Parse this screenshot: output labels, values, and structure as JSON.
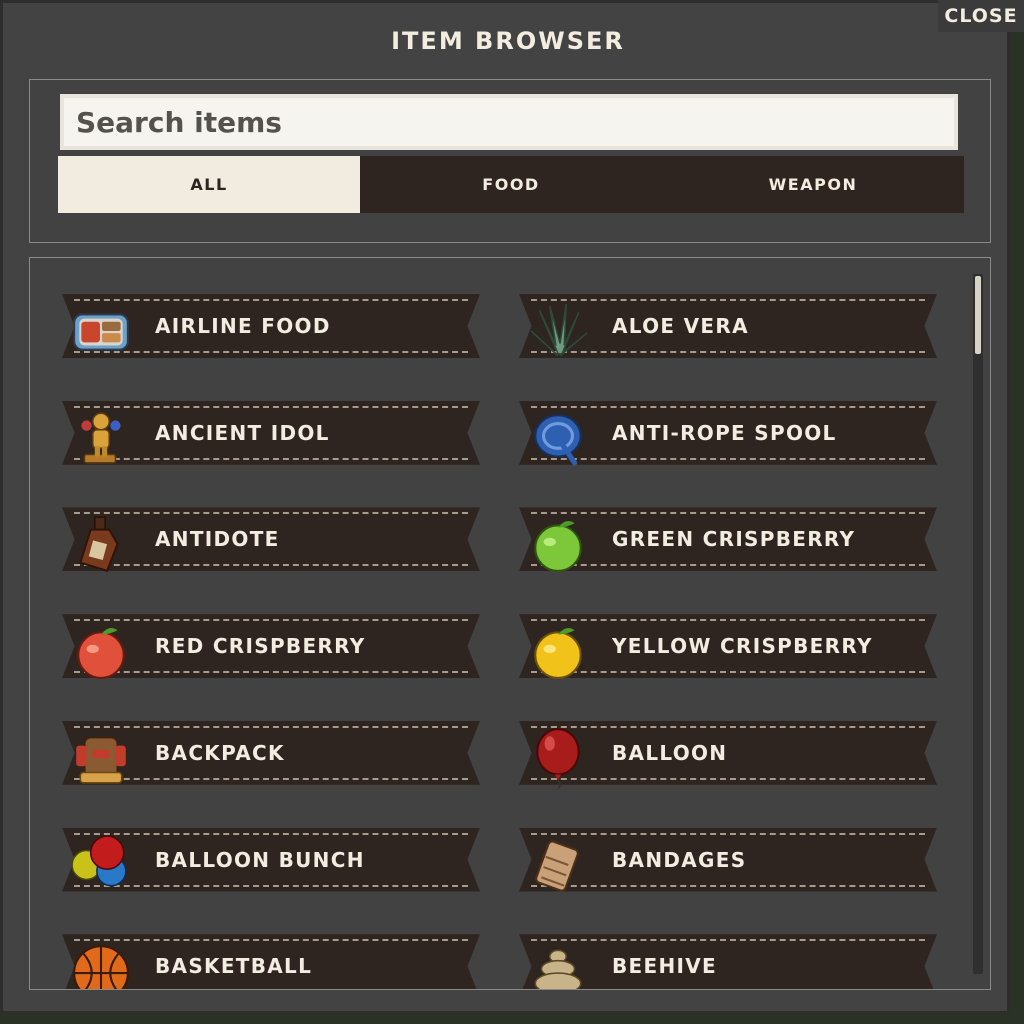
{
  "window": {
    "title": "ITEM BROWSER",
    "close_label": "CLOSE"
  },
  "search": {
    "placeholder": "Search items",
    "value": ""
  },
  "tabs": [
    {
      "label": "ALL",
      "active": true
    },
    {
      "label": "FOOD",
      "active": false
    },
    {
      "label": "WEAPON",
      "active": false
    }
  ],
  "items": [
    {
      "label": "AIRLINE FOOD",
      "icon": "airline-food-icon"
    },
    {
      "label": "ALOE VERA",
      "icon": "aloe-vera-icon"
    },
    {
      "label": "ANCIENT IDOL",
      "icon": "ancient-idol-icon"
    },
    {
      "label": "ANTI-ROPE SPOOL",
      "icon": "anti-rope-spool-icon"
    },
    {
      "label": "ANTIDOTE",
      "icon": "antidote-icon"
    },
    {
      "label": "GREEN CRISPBERRY",
      "icon": "green-crispberry-icon"
    },
    {
      "label": "RED CRISPBERRY",
      "icon": "red-crispberry-icon"
    },
    {
      "label": "YELLOW CRISPBERRY",
      "icon": "yellow-crispberry-icon"
    },
    {
      "label": "BACKPACK",
      "icon": "backpack-icon"
    },
    {
      "label": "BALLOON",
      "icon": "balloon-icon"
    },
    {
      "label": "BALLOON BUNCH",
      "icon": "balloon-bunch-icon"
    },
    {
      "label": "BANDAGES",
      "icon": "bandages-icon"
    },
    {
      "label": "BASKETBALL",
      "icon": "basketball-icon"
    },
    {
      "label": "BEEHIVE",
      "icon": "beehive-icon"
    }
  ],
  "colors": {
    "panel": "#434343",
    "ribbon": "#2e2520",
    "text_light": "#f3ece0",
    "active_tab": "#f1ebe0"
  }
}
